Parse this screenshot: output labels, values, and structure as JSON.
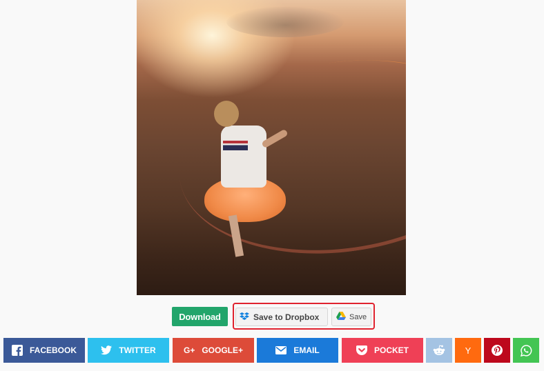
{
  "actions": {
    "download_label": "Download",
    "dropbox_label": "Save to Dropbox",
    "drive_label": "Save"
  },
  "share": {
    "facebook": "FACEBOOK",
    "twitter": "TWITTER",
    "google": "GOOGLE+",
    "google_icon_text": "G+",
    "email": "EMAIL",
    "pocket": "POCKET",
    "hackernews_icon_text": "Y"
  },
  "colors": {
    "download": "#22a56b",
    "highlight": "#e0222e",
    "facebook": "#3b5998",
    "twitter": "#2dc0ee",
    "google": "#dd4b39",
    "email": "#1b7ad9",
    "pocket": "#ef4056",
    "reddit": "#a4c3e3",
    "hackernews": "#ff6a0f",
    "pinterest": "#bd081c",
    "whatsapp": "#43c553"
  },
  "icons": [
    "dropbox-icon",
    "google-drive-icon",
    "facebook-icon",
    "twitter-icon",
    "google-plus-icon",
    "email-icon",
    "pocket-icon",
    "reddit-icon",
    "hackernews-icon",
    "pinterest-icon",
    "whatsapp-icon"
  ]
}
